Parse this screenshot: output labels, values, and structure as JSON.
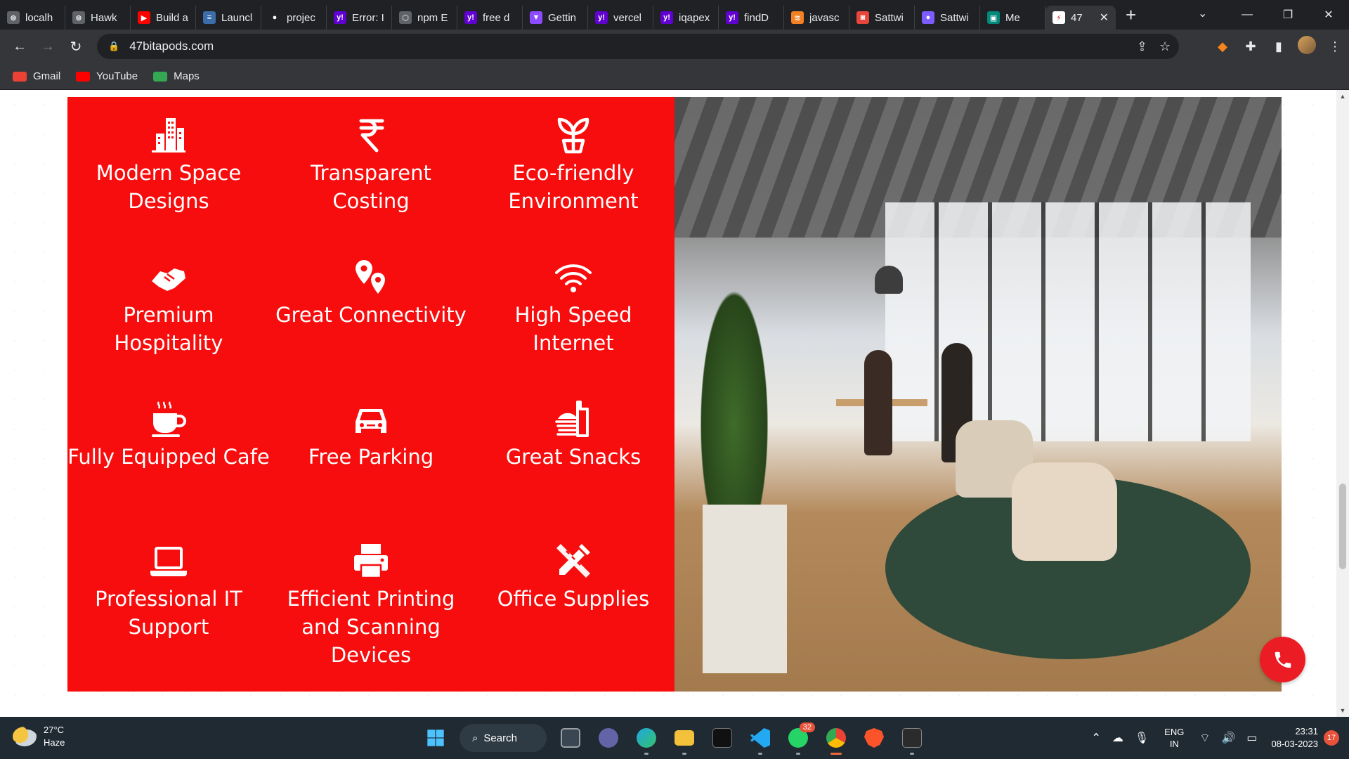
{
  "browser": {
    "tabs": [
      {
        "label": "localh",
        "icon": "localhost-icon",
        "color": "#5f6368",
        "glyph": "⊚"
      },
      {
        "label": "Hawk",
        "icon": "hawk-icon",
        "color": "#5f6368",
        "glyph": "⊚"
      },
      {
        "label": "Build a",
        "icon": "youtube-icon",
        "color": "#ff0000",
        "glyph": "▶"
      },
      {
        "label": "Launcl",
        "icon": "launch-icon",
        "color": "#3b6ea8",
        "glyph": "≡"
      },
      {
        "label": "projec",
        "icon": "github-icon",
        "color": "#202124",
        "glyph": "●"
      },
      {
        "label": "Error: I",
        "icon": "yahoo-icon",
        "color": "#6001d2",
        "glyph": "y!"
      },
      {
        "label": "npm E",
        "icon": "npm-icon",
        "color": "#5f6368",
        "glyph": "⬡"
      },
      {
        "label": "free d",
        "icon": "yahoo-icon",
        "color": "#6001d2",
        "glyph": "y!"
      },
      {
        "label": "Gettin",
        "icon": "vite-icon",
        "color": "#8c4bff",
        "glyph": "▼"
      },
      {
        "label": "vercel",
        "icon": "yahoo-icon",
        "color": "#6001d2",
        "glyph": "y!"
      },
      {
        "label": "iqapex",
        "icon": "yahoo-icon",
        "color": "#6001d2",
        "glyph": "y!"
      },
      {
        "label": "findD",
        "icon": "yahoo-icon",
        "color": "#6001d2",
        "glyph": "y!"
      },
      {
        "label": "javasc",
        "icon": "stackoverflow-icon",
        "color": "#f48024",
        "glyph": "≋"
      },
      {
        "label": "Sattwi",
        "icon": "app-icon",
        "color": "#e8453c",
        "glyph": "◙"
      },
      {
        "label": "Sattwi",
        "icon": "app-circle-icon",
        "color": "#7c5cff",
        "glyph": "●"
      },
      {
        "label": "Me",
        "icon": "meet-icon",
        "color": "#00897b",
        "glyph": "▣"
      }
    ],
    "active_tab": {
      "label": "47",
      "icon": "47bitapods-icon"
    },
    "new_tab": "+",
    "url": "47bitapods.com"
  },
  "bookmarks": [
    {
      "label": "Gmail",
      "icon": "gmail-icon",
      "color": "#ea4335"
    },
    {
      "label": "YouTube",
      "icon": "youtube-icon",
      "color": "#ff0000"
    },
    {
      "label": "Maps",
      "icon": "maps-icon",
      "color": "#34a853"
    }
  ],
  "features": [
    {
      "label": "Modern Space Designs",
      "icon": "building-icon"
    },
    {
      "label": "Transparent Costing",
      "icon": "rupee-icon"
    },
    {
      "label": "Eco-friendly Environment",
      "icon": "seedling-icon"
    },
    {
      "label": "Premium Hospitality",
      "icon": "handshake-icon"
    },
    {
      "label": "Great Connectivity",
      "icon": "location-pins-icon"
    },
    {
      "label": "High Speed Internet",
      "icon": "wifi-icon"
    },
    {
      "label": "Fully Equipped Cafe",
      "icon": "coffee-cup-icon"
    },
    {
      "label": "Free Parking",
      "icon": "car-icon"
    },
    {
      "label": "Great Snacks",
      "icon": "snacks-icon"
    },
    {
      "label": "Professional IT Support",
      "icon": "laptop-icon"
    },
    {
      "label": "Efficient Printing and Scanning Devices",
      "icon": "printer-icon"
    },
    {
      "label": "Office Supplies",
      "icon": "office-supplies-icon"
    }
  ],
  "colors": {
    "feature_bg": "#f70d0d",
    "call_button": "#ec1c24"
  },
  "taskbar": {
    "weather_temp": "27°C",
    "weather_desc": "Haze",
    "search_label": "Search",
    "whatsapp_badge": "32",
    "lang_top": "ENG",
    "lang_bottom": "IN",
    "time": "23:31",
    "date": "08-03-2023",
    "notifications": "17"
  }
}
